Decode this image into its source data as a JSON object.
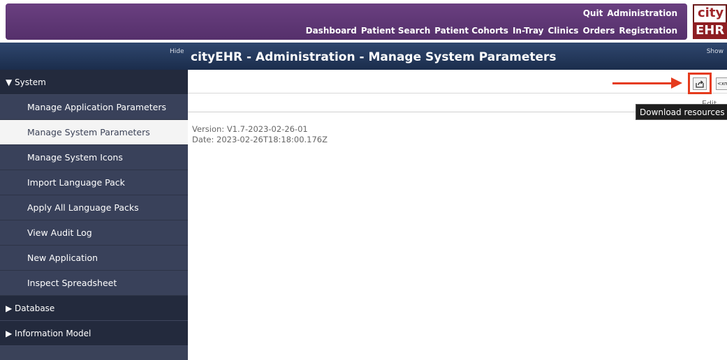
{
  "header": {
    "row1": [
      "Quit",
      "Administration"
    ],
    "row2": [
      "Dashboard",
      "Patient Search",
      "Patient Cohorts",
      "In-Tray",
      "Clinics",
      "Orders",
      "Registration"
    ],
    "logo_top": "city",
    "logo_bottom": "EHR"
  },
  "titlebar": {
    "hide_label": "Hide",
    "title": "cityEHR - Administration - Manage System Parameters",
    "show_label": "Show"
  },
  "sidebar": {
    "sections": [
      {
        "label": "▼ System",
        "expanded": true
      },
      {
        "label": "▶ Database",
        "expanded": false
      },
      {
        "label": "▶ Information Model",
        "expanded": false
      }
    ],
    "items": [
      {
        "label": "Manage Application Parameters",
        "active": false
      },
      {
        "label": "Manage System Parameters",
        "active": true
      },
      {
        "label": "Manage System Icons",
        "active": false
      },
      {
        "label": "Import Language Pack",
        "active": false
      },
      {
        "label": "Apply All Language Packs",
        "active": false
      },
      {
        "label": "View Audit Log",
        "active": false
      },
      {
        "label": "New Application",
        "active": false
      },
      {
        "label": "Inspect Spreadsheet",
        "active": false
      }
    ]
  },
  "main": {
    "download_icon": "share-export-icon",
    "xml_button_label": "<xml/>",
    "edit_label": "Edit",
    "tooltip": "Download resources",
    "version": "Version: V1.7-2023-02-26-01",
    "date": "Date: 2023-02-26T18:18:00.176Z"
  },
  "colors": {
    "header_purple": "#5f3775",
    "titlebar_navy": "#253a5e",
    "sidebar_dark": "#39415a",
    "highlight_red": "#e53b1d"
  }
}
